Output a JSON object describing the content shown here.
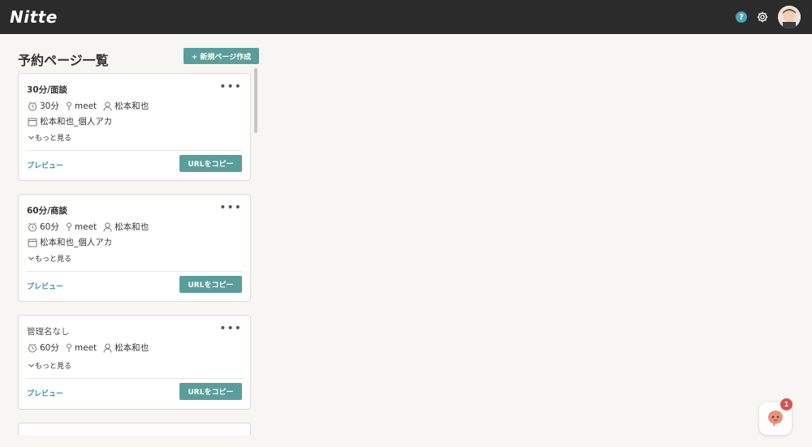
{
  "app": {
    "logo": "Nitte"
  },
  "header": {
    "help_label": "?"
  },
  "page": {
    "title": "予約ページ一覧",
    "new_button_label": "+ 新規ページ作成"
  },
  "cards": [
    {
      "title": "30分/面談",
      "duration": "30分",
      "location": "meet",
      "host": "松本和也",
      "calendar": "松本和也_個人アカ",
      "see_more": "もっと見る",
      "preview": "プレビュー",
      "copy_url": "URLをコピー"
    },
    {
      "title": "60分/商談",
      "duration": "60分",
      "location": "meet",
      "host": "松本和也",
      "calendar": "松本和也_個人アカ",
      "see_more": "もっと見る",
      "preview": "プレビュー",
      "copy_url": "URLをコピー"
    },
    {
      "title": "管理名なし",
      "duration": "60分",
      "location": "meet",
      "host": "松本和也",
      "see_more": "もっと見る",
      "preview": "プレビュー",
      "copy_url": "URLをコピー"
    }
  ],
  "chat": {
    "badge_count": "1"
  },
  "colors": {
    "accent": "#5a9e9c",
    "link": "#3a8fb7",
    "topbar": "#2b2b2b",
    "badge": "#d9534f"
  }
}
